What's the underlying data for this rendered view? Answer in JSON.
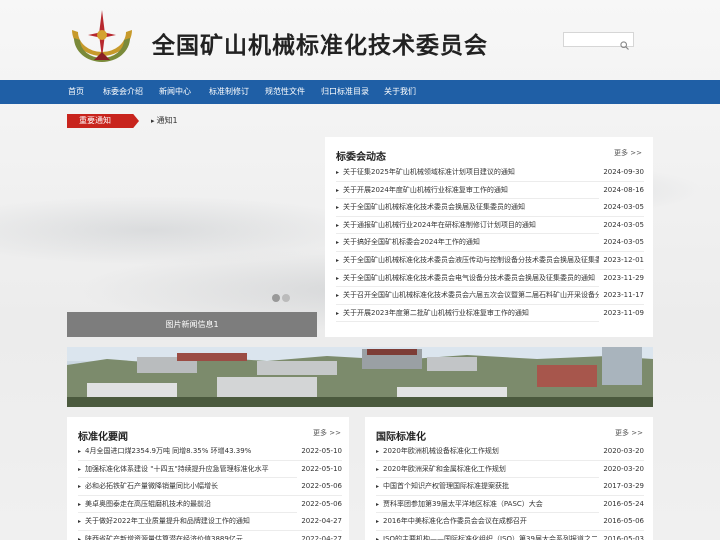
{
  "site": {
    "title": "全国矿山机械标准化技术委员会"
  },
  "search": {
    "placeholder": "",
    "icon": "search-icon"
  },
  "nav": {
    "items": [
      "首页",
      "标委会介绍",
      "新闻中心",
      "标准制修订",
      "规范性文件",
      "归口标准目录",
      "关于我们"
    ]
  },
  "notice": {
    "tag": "重要通知",
    "item": "通知1"
  },
  "slider": {
    "caption": "图片新闻信息1",
    "dots": 2,
    "active": 1
  },
  "committee": {
    "title": "标委会动态",
    "more": "更多 >>",
    "items": [
      {
        "title": "关于征集2025年矿山机械领域标准计划项目建议的通知",
        "date": "2024-09-30"
      },
      {
        "title": "关于开展2024年度矿山机械行业标准复审工作的通知",
        "date": "2024-08-16"
      },
      {
        "title": "关于全国矿山机械标准化技术委员会换届及征集委员的通知",
        "date": "2024-03-05"
      },
      {
        "title": "关于通报矿山机械行业2024年在研标准制修订计划项目的通知",
        "date": "2024-03-05"
      },
      {
        "title": "关于搞好全国矿机标委会2024年工作的通知",
        "date": "2024-03-05"
      },
      {
        "title": "关于全国矿山机械标准化技术委员会液压传动与控制设备分技术委员会换届及征集委员的通知",
        "date": "2023-12-01"
      },
      {
        "title": "关于全国矿山机械标准化技术委员会电气设备分技术委员会换届及征集委员的通知",
        "date": "2023-11-29"
      },
      {
        "title": "关于召开全国矿山机械标准化技术委员会六届五次会议暨第二届石料矿山开采设备分技术委员会会议的通知",
        "date": "2023-11-17"
      },
      {
        "title": "关于开展2023年度第二批矿山机械行业标准复审工作的通知",
        "date": "2023-11-09"
      }
    ]
  },
  "standardization": {
    "title": "标准化要闻",
    "more": "更多 >>",
    "items": [
      {
        "title": "4月全国进口煤2354.9万吨 同增8.35% 环增43.39%",
        "date": "2022-05-10"
      },
      {
        "title": "加强标准化体系建设 \"十四五\"持续提升应急管理标准化水平",
        "date": "2022-05-10"
      },
      {
        "title": "必和必拓铁矿石产量微降销量同比小幅增长",
        "date": "2022-05-06"
      },
      {
        "title": "美卓奥图泰走在高压辊磨机技术的最前沿",
        "date": "2022-05-06"
      },
      {
        "title": "关于做好2022年工业质量提升和品牌建设工作的通知",
        "date": "2022-04-27"
      },
      {
        "title": "陕西省矿产新增资源量估算潜在经济价值3889亿元",
        "date": "2022-04-27"
      }
    ]
  },
  "international": {
    "title": "国际标准化",
    "more": "更多 >>",
    "items": [
      {
        "title": "2020年欧洲机械设备标准化工作规划",
        "date": "2020-03-20"
      },
      {
        "title": "2020年欧洲采矿和金属标准化工作规划",
        "date": "2020-03-20"
      },
      {
        "title": "中国首个知识产权管理国际标准提案获批",
        "date": "2017-03-29"
      },
      {
        "title": "贾科率团参加第39届太平洋地区标准（PASC）大会",
        "date": "2016-05-24"
      },
      {
        "title": "2016年中美标准化合作委员会会议在成都召开",
        "date": "2016-05-06"
      },
      {
        "title": "ISO的主要机构——国际标准化组织（ISO）第39届大会系列报道之二",
        "date": "2016-05-03"
      }
    ]
  },
  "colors": {
    "nav": "#1f5fa6",
    "notice_tag": "#c8241d",
    "caption": "#7d7d7d"
  }
}
